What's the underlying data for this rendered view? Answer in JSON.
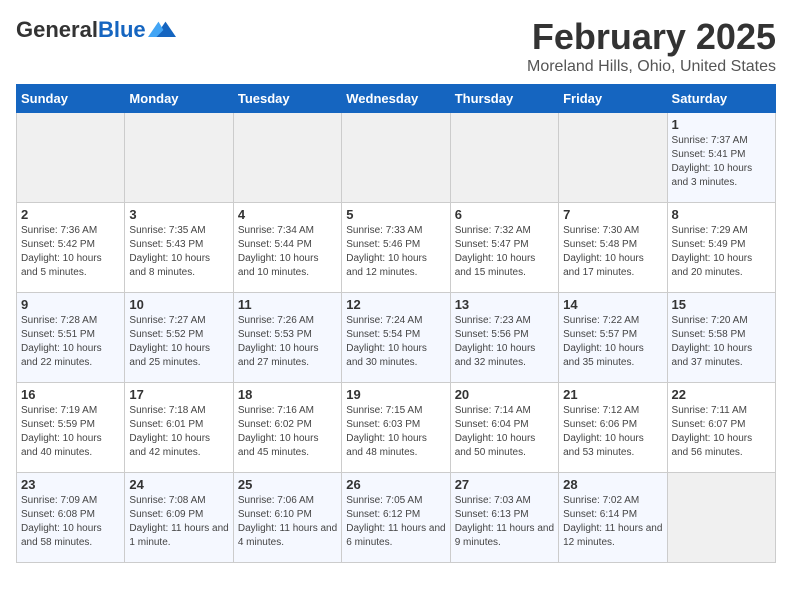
{
  "logo": {
    "general": "General",
    "blue": "Blue"
  },
  "header": {
    "title": "February 2025",
    "subtitle": "Moreland Hills, Ohio, United States"
  },
  "weekdays": [
    "Sunday",
    "Monday",
    "Tuesday",
    "Wednesday",
    "Thursday",
    "Friday",
    "Saturday"
  ],
  "weeks": [
    [
      {
        "day": "",
        "info": ""
      },
      {
        "day": "",
        "info": ""
      },
      {
        "day": "",
        "info": ""
      },
      {
        "day": "",
        "info": ""
      },
      {
        "day": "",
        "info": ""
      },
      {
        "day": "",
        "info": ""
      },
      {
        "day": "1",
        "info": "Sunrise: 7:37 AM\nSunset: 5:41 PM\nDaylight: 10 hours and 3 minutes."
      }
    ],
    [
      {
        "day": "2",
        "info": "Sunrise: 7:36 AM\nSunset: 5:42 PM\nDaylight: 10 hours and 5 minutes."
      },
      {
        "day": "3",
        "info": "Sunrise: 7:35 AM\nSunset: 5:43 PM\nDaylight: 10 hours and 8 minutes."
      },
      {
        "day": "4",
        "info": "Sunrise: 7:34 AM\nSunset: 5:44 PM\nDaylight: 10 hours and 10 minutes."
      },
      {
        "day": "5",
        "info": "Sunrise: 7:33 AM\nSunset: 5:46 PM\nDaylight: 10 hours and 12 minutes."
      },
      {
        "day": "6",
        "info": "Sunrise: 7:32 AM\nSunset: 5:47 PM\nDaylight: 10 hours and 15 minutes."
      },
      {
        "day": "7",
        "info": "Sunrise: 7:30 AM\nSunset: 5:48 PM\nDaylight: 10 hours and 17 minutes."
      },
      {
        "day": "8",
        "info": "Sunrise: 7:29 AM\nSunset: 5:49 PM\nDaylight: 10 hours and 20 minutes."
      }
    ],
    [
      {
        "day": "9",
        "info": "Sunrise: 7:28 AM\nSunset: 5:51 PM\nDaylight: 10 hours and 22 minutes."
      },
      {
        "day": "10",
        "info": "Sunrise: 7:27 AM\nSunset: 5:52 PM\nDaylight: 10 hours and 25 minutes."
      },
      {
        "day": "11",
        "info": "Sunrise: 7:26 AM\nSunset: 5:53 PM\nDaylight: 10 hours and 27 minutes."
      },
      {
        "day": "12",
        "info": "Sunrise: 7:24 AM\nSunset: 5:54 PM\nDaylight: 10 hours and 30 minutes."
      },
      {
        "day": "13",
        "info": "Sunrise: 7:23 AM\nSunset: 5:56 PM\nDaylight: 10 hours and 32 minutes."
      },
      {
        "day": "14",
        "info": "Sunrise: 7:22 AM\nSunset: 5:57 PM\nDaylight: 10 hours and 35 minutes."
      },
      {
        "day": "15",
        "info": "Sunrise: 7:20 AM\nSunset: 5:58 PM\nDaylight: 10 hours and 37 minutes."
      }
    ],
    [
      {
        "day": "16",
        "info": "Sunrise: 7:19 AM\nSunset: 5:59 PM\nDaylight: 10 hours and 40 minutes."
      },
      {
        "day": "17",
        "info": "Sunrise: 7:18 AM\nSunset: 6:01 PM\nDaylight: 10 hours and 42 minutes."
      },
      {
        "day": "18",
        "info": "Sunrise: 7:16 AM\nSunset: 6:02 PM\nDaylight: 10 hours and 45 minutes."
      },
      {
        "day": "19",
        "info": "Sunrise: 7:15 AM\nSunset: 6:03 PM\nDaylight: 10 hours and 48 minutes."
      },
      {
        "day": "20",
        "info": "Sunrise: 7:14 AM\nSunset: 6:04 PM\nDaylight: 10 hours and 50 minutes."
      },
      {
        "day": "21",
        "info": "Sunrise: 7:12 AM\nSunset: 6:06 PM\nDaylight: 10 hours and 53 minutes."
      },
      {
        "day": "22",
        "info": "Sunrise: 7:11 AM\nSunset: 6:07 PM\nDaylight: 10 hours and 56 minutes."
      }
    ],
    [
      {
        "day": "23",
        "info": "Sunrise: 7:09 AM\nSunset: 6:08 PM\nDaylight: 10 hours and 58 minutes."
      },
      {
        "day": "24",
        "info": "Sunrise: 7:08 AM\nSunset: 6:09 PM\nDaylight: 11 hours and 1 minute."
      },
      {
        "day": "25",
        "info": "Sunrise: 7:06 AM\nSunset: 6:10 PM\nDaylight: 11 hours and 4 minutes."
      },
      {
        "day": "26",
        "info": "Sunrise: 7:05 AM\nSunset: 6:12 PM\nDaylight: 11 hours and 6 minutes."
      },
      {
        "day": "27",
        "info": "Sunrise: 7:03 AM\nSunset: 6:13 PM\nDaylight: 11 hours and 9 minutes."
      },
      {
        "day": "28",
        "info": "Sunrise: 7:02 AM\nSunset: 6:14 PM\nDaylight: 11 hours and 12 minutes."
      },
      {
        "day": "",
        "info": ""
      }
    ]
  ]
}
